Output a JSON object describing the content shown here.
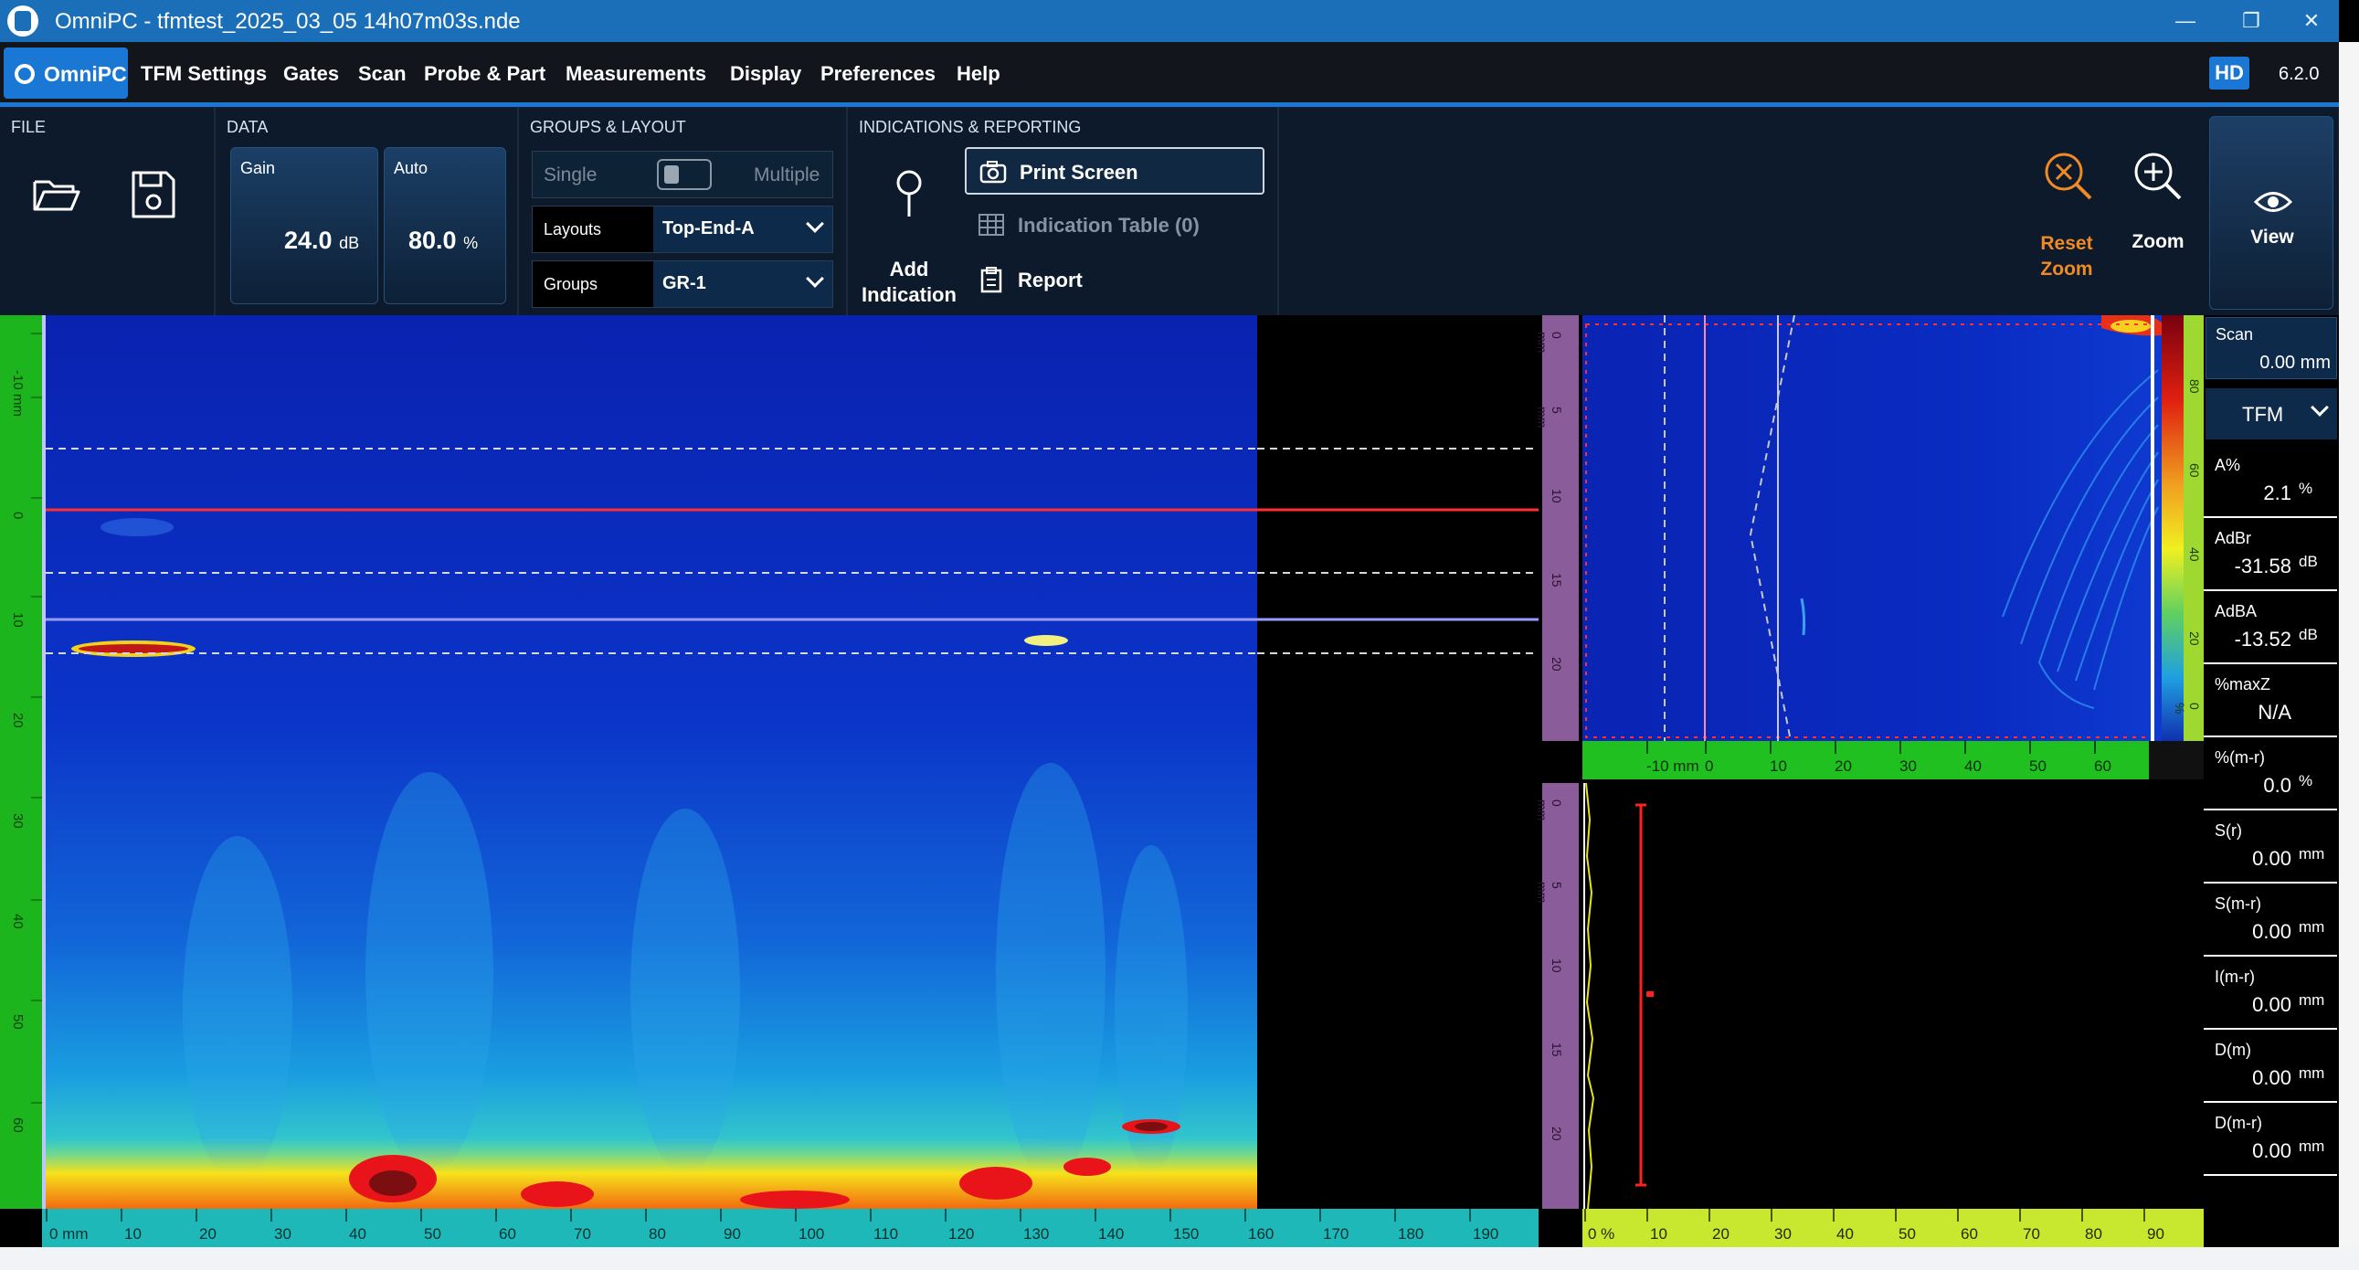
{
  "window": {
    "title": "OmniPC - tfmtest_2025_03_05 14h07m03s.nde",
    "controls": [
      "—",
      "❐",
      "✕"
    ]
  },
  "menubar": {
    "brand": "OmniPC",
    "items": [
      "TFM Settings",
      "Gates",
      "Scan",
      "Probe & Part",
      "Measurements",
      "Display",
      "Preferences",
      "Help"
    ],
    "hd_badge": "HD",
    "version": "6.2.0"
  },
  "ribbon": {
    "file": {
      "label": "FILE",
      "open": "Open",
      "save": "Save"
    },
    "data": {
      "label": "DATA",
      "gain": {
        "label": "Gain",
        "value": "24.0",
        "unit": "dB"
      },
      "auto": {
        "label": "Auto",
        "value": "80.0",
        "unit": "%"
      }
    },
    "groups_layout": {
      "label": "GROUPS & LAYOUT",
      "toggle_left": "Single",
      "toggle_right": "Multiple",
      "layouts_label": "Layouts",
      "layouts_value": "Top-End-A",
      "groups_label": "Groups",
      "groups_value": "GR-1"
    },
    "indications": {
      "label": "INDICATIONS & REPORTING",
      "add_indication": "Add Indication",
      "print_screen": "Print Screen",
      "indication_table": "Indication Table (0)",
      "report": "Report"
    },
    "view_controls": {
      "reset_zoom": "Reset Zoom",
      "zoom": "Zoom",
      "view": "View"
    }
  },
  "scan_view": {
    "bottom_axis_ticks": [
      "0 mm",
      "10",
      "20",
      "30",
      "40",
      "50",
      "60",
      "70",
      "80",
      "90",
      "100",
      "110",
      "120",
      "130",
      "140",
      "150",
      "160",
      "170",
      "180",
      "190"
    ],
    "left_axis_ticks": [
      "-10 mm",
      "0",
      "10",
      "20",
      "30",
      "40",
      "50",
      "60"
    ]
  },
  "end_view": {
    "bottom_axis_ticks": [
      "-10 mm",
      "0",
      "10",
      "20",
      "30",
      "40",
      "50",
      "60"
    ],
    "left_axis_ticks": [
      "0 mm",
      "5 mm",
      "10",
      "15",
      "20"
    ],
    "right_axis_ticks": [
      "80",
      "60",
      "40",
      "20",
      "0 %"
    ]
  },
  "ascan_view": {
    "bottom_axis_ticks": [
      "0 %",
      "10",
      "20",
      "30",
      "40",
      "50",
      "60",
      "70",
      "80",
      "90"
    ],
    "left_axis_ticks": [
      "0 mm",
      "5 mm",
      "10",
      "15",
      "20"
    ]
  },
  "readings": {
    "scan": {
      "label": "Scan",
      "value": "0.00 mm"
    },
    "mode": "TFM",
    "items": [
      {
        "label": "A%",
        "value": "2.1",
        "unit": "%"
      },
      {
        "label": "AdBr",
        "value": "-31.58",
        "unit": "dB"
      },
      {
        "label": "AdBA",
        "value": "-13.52",
        "unit": "dB"
      },
      {
        "label": "%maxZ",
        "value": "N/A",
        "unit": ""
      },
      {
        "label": "%(m-r)",
        "value": "0.0",
        "unit": "%"
      },
      {
        "label": "S(r)",
        "value": "0.00",
        "unit": "mm"
      },
      {
        "label": "S(m-r)",
        "value": "0.00",
        "unit": "mm"
      },
      {
        "label": "I(m-r)",
        "value": "0.00",
        "unit": "mm"
      },
      {
        "label": "D(m)",
        "value": "0.00",
        "unit": "mm"
      },
      {
        "label": "D(m-r)",
        "value": "0.00",
        "unit": "mm"
      }
    ]
  },
  "colors": {
    "accent": "#1a78d4",
    "ribbon_bg": "#0c1a2c",
    "reset_zoom": "#f08a24",
    "scan_ruler": "#1db51d",
    "bottom_ruler": "#1fb8b8",
    "end_ruler": "#20c020",
    "ascan_ruler": "#c8e830"
  }
}
